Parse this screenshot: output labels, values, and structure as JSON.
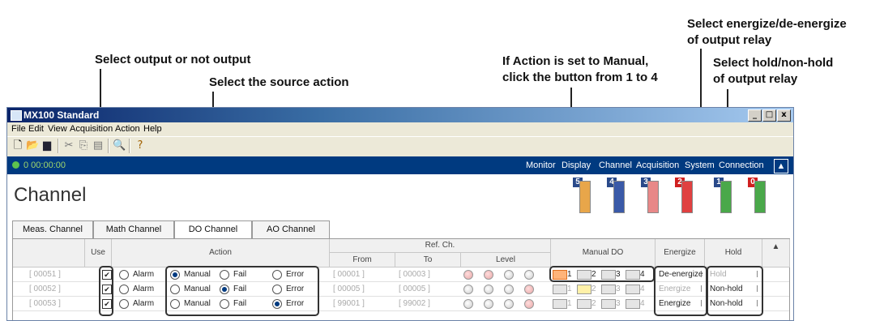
{
  "callouts": {
    "output": "Select output or not output",
    "source_action": "Select the source action",
    "manual": "If Action is set to Manual,\nclick the button from 1 to 4",
    "energize": "Select energize/de-energize\nof output relay",
    "hold": "Select hold/non-hold\nof output relay"
  },
  "window": {
    "title": "MX100 Standard",
    "controls": [
      "_",
      "□",
      "x"
    ]
  },
  "menu": [
    "File",
    "Edit",
    "View",
    "Acquisition",
    "Action",
    "Help"
  ],
  "toolbar_icons": [
    "new-icon",
    "open-icon",
    "save-icon",
    "cut-icon",
    "copy-icon",
    "paste-icon",
    "zoom-icon",
    "help-icon"
  ],
  "nav": {
    "clock": "0 00:00:00",
    "items": [
      "Monitor",
      "Display",
      "Channel",
      "Acquisition",
      "System",
      "Connection"
    ],
    "active": "Channel"
  },
  "page_title": "Channel",
  "modules": [
    {
      "num": "5",
      "color": "#e8a64a"
    },
    {
      "num": "4",
      "color": "#3a5aa8"
    },
    {
      "num": "3",
      "color": "#e88888"
    },
    {
      "num": "2",
      "color": "#e04040"
    },
    {
      "num": "1",
      "color": "#4aa84a"
    },
    {
      "num": "0",
      "color": "#4aa84a"
    }
  ],
  "tabs": [
    "Meas. Channel",
    "Math Channel",
    "DO Channel",
    "AO Channel"
  ],
  "active_tab": "DO Channel",
  "columns": {
    "use": "Use",
    "action": "Action",
    "ref_ch": "Ref. Ch.",
    "from": "From",
    "to": "To",
    "level": "Level",
    "manual_do": "Manual DO",
    "energize": "Energize",
    "hold": "Hold",
    "sort_icon": "▲"
  },
  "action_options": [
    "Alarm",
    "Manual",
    "Fail",
    "Error"
  ],
  "rows": [
    {
      "ch": "[ 00051 ]",
      "use": true,
      "action": "Manual",
      "from": "[ 00001 ]",
      "to": "[ 00003 ]",
      "manual_on": 1,
      "energize": "De-energize",
      "hold": "Hold"
    },
    {
      "ch": "[ 00052 ]",
      "use": true,
      "action": "Fail",
      "from": "[ 00005 ]",
      "to": "[ 00005 ]",
      "manual_on": 0,
      "energize": "Energize",
      "hold": "Non-hold"
    },
    {
      "ch": "[ 00053 ]",
      "use": true,
      "action": "Error",
      "from": "[ 99001 ]",
      "to": "[ 99002 ]",
      "manual_on": 0,
      "energize": "Energize",
      "hold": "Non-hold"
    }
  ],
  "do_labels": [
    "1",
    "2",
    "3",
    "4"
  ]
}
